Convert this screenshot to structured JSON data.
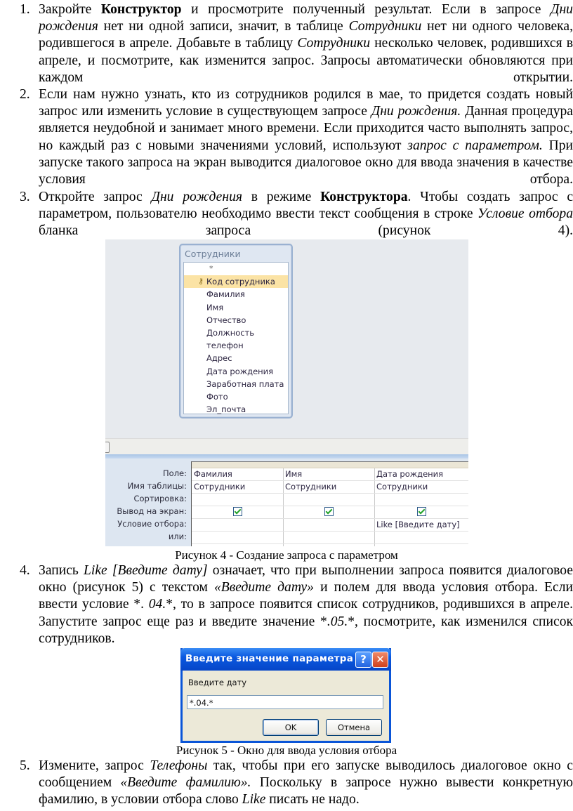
{
  "items": [
    {
      "number": "1.",
      "parts": [
        {
          "t": "Закройте "
        },
        {
          "t": "Конструктор",
          "b": true
        },
        {
          "t": " и просмотрите полученный результат. Если в запросе "
        },
        {
          "t": "Дни рождения",
          "i": true
        },
        {
          "t": " нет ни одной записи, значит, в таблице "
        },
        {
          "t": "Сотрудники",
          "i": true
        },
        {
          "t": " нет ни одного человека, родившегося в апреле. Добавьте в таблицу "
        },
        {
          "t": "Сотрудники",
          "i": true
        },
        {
          "t": " несколько человек, родившихся в апреле, и посмотрите, как изменится запрос. Запросы автоматически обновляются при каждом открытии."
        }
      ]
    },
    {
      "number": "2.",
      "parts": [
        {
          "t": "Если нам нужно узнать, кто из сотрудников родился в мае, то придется создать новый запрос или изменить условие в существующем запросе "
        },
        {
          "t": "Дни рождения.",
          "i": true
        },
        {
          "t": " Данная процедура является неудобной и занимает много времени. Если приходится часто выполнять запрос, но каждый раз с новыми значениями условий, используют "
        },
        {
          "t": "запрос с параметром.",
          "i": true
        },
        {
          "t": " При запуске такого запроса на экран выводится диалоговое окно для ввода значения в качестве условия отбора."
        }
      ]
    },
    {
      "number": "3.",
      "parts": [
        {
          "t": "Откройте запрос "
        },
        {
          "t": "Дни рождения",
          "i": true
        },
        {
          "t": " в режиме "
        },
        {
          "t": "Конструктора",
          "b": true
        },
        {
          "t": ". Чтобы создать запрос с параметром, пользователю необходимо ввести текст сообщения в строке "
        },
        {
          "t": "Условие отбора",
          "i": true
        },
        {
          "t": " бланка запроса (рисунок 4)."
        }
      ]
    },
    {
      "number": "4.",
      "parts": [
        {
          "t": "Запись "
        },
        {
          "t": "Like [Введите дату]",
          "i": true
        },
        {
          "t": " означает, что при выполнении запроса появится диалоговое окно (рисунок 5) с текстом "
        },
        {
          "t": "«Введите дату»",
          "i": true
        },
        {
          "t": " и полем для ввода условия отбора. Если ввести условие *. "
        },
        {
          "t": "04.",
          "i": true
        },
        {
          "t": "*, то в запросе появится список сотрудников, родившихся в апреле. Запустите запрос еще раз и введите значение *"
        },
        {
          "t": ".05.",
          "i": true
        },
        {
          "t": "*, посмотрите, как изменился список сотрудников."
        }
      ]
    },
    {
      "number": "5.",
      "parts": [
        {
          "t": "Измените, запрос "
        },
        {
          "t": "Телефоны",
          "i": true
        },
        {
          "t": " так, чтобы при его запуске выводилось диалоговое окно с сообщением "
        },
        {
          "t": "«Введите фамилию».",
          "i": true
        },
        {
          "t": " Поскольку в запросе нужно вывести конкретную фамилию, в условии отбора слово "
        },
        {
          "t": "Like",
          "i": true
        },
        {
          "t": " писать не надо."
        }
      ]
    }
  ],
  "figure4": {
    "caption": "Рисунок 4 - Создание запроса с параметром",
    "table": {
      "title": "Сотрудники",
      "fields": [
        "*",
        "Код сотрудника",
        "Фамилия",
        "Имя",
        "Отчество",
        "Должность",
        "телефон",
        "Адрес",
        "Дата рождения",
        "Заработная плата",
        "Фото",
        "Эл_почта"
      ],
      "key_field_index": 1,
      "key_icon": "primary-key-icon"
    },
    "grid": {
      "row_labels": [
        "Поле:",
        "Имя таблицы:",
        "Сортировка:",
        "Вывод на экран:",
        "Условие отбора:",
        "или:"
      ],
      "columns": [
        {
          "field": "Фамилия",
          "table": "Сотрудники",
          "sort": "",
          "show": true,
          "criteria": "",
          "or": ""
        },
        {
          "field": "Имя",
          "table": "Сотрудники",
          "sort": "",
          "show": true,
          "criteria": "",
          "or": ""
        },
        {
          "field": "Дата рождения",
          "table": "Сотрудники",
          "sort": "",
          "show": true,
          "criteria": "Like [Введите дату]",
          "or": ""
        }
      ]
    }
  },
  "figure5": {
    "caption": "Рисунок 5 - Окно для ввода условия отбора",
    "dialog": {
      "title": "Введите значение параметра",
      "help_label": "?",
      "close_label": "✕",
      "prompt": "Введите дату",
      "input_value": "*.04.*",
      "ok_label": "OK",
      "cancel_label": "Отмена"
    }
  }
}
